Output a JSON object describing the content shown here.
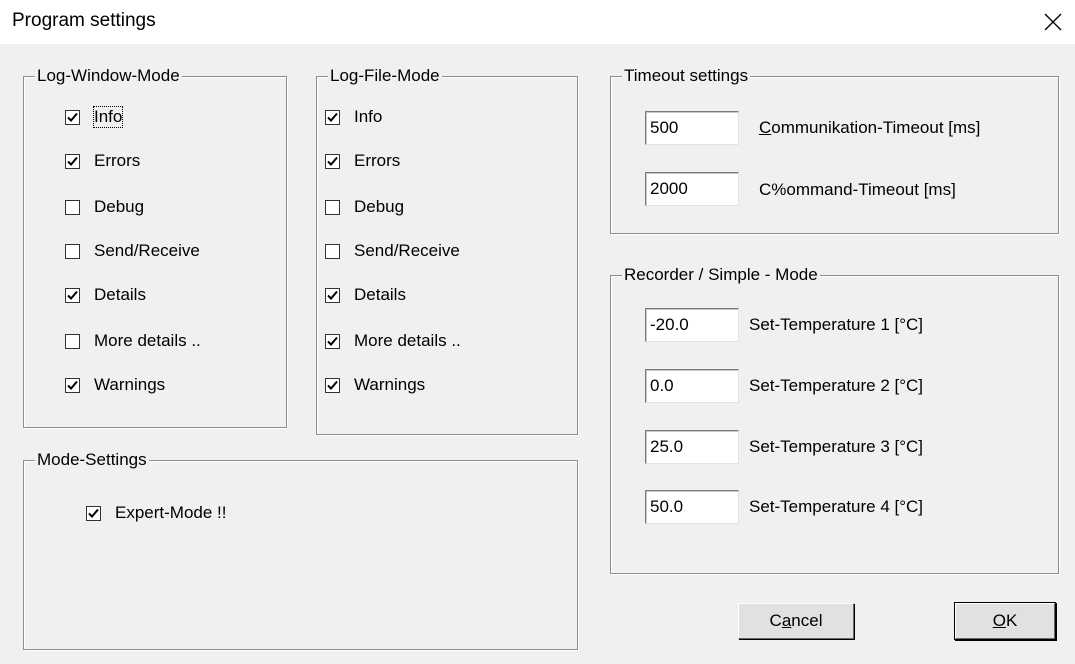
{
  "window": {
    "title": "Program settings"
  },
  "log_window_mode": {
    "legend": "Log-Window-Mode",
    "items": [
      {
        "label": "Info",
        "checked": true
      },
      {
        "label": "Errors",
        "checked": true
      },
      {
        "label": "Debug",
        "checked": false
      },
      {
        "label": "Send/Receive",
        "checked": false
      },
      {
        "label": "Details",
        "checked": true
      },
      {
        "label": "More details ..",
        "checked": false
      },
      {
        "label": "Warnings",
        "checked": true
      }
    ]
  },
  "log_file_mode": {
    "legend": "Log-File-Mode",
    "items": [
      {
        "label": "Info",
        "checked": true
      },
      {
        "label": "Errors",
        "checked": true
      },
      {
        "label": "Debug",
        "checked": false
      },
      {
        "label": "Send/Receive",
        "checked": false
      },
      {
        "label": "Details",
        "checked": true
      },
      {
        "label": "More details ..",
        "checked": true
      },
      {
        "label": "Warnings",
        "checked": true
      }
    ]
  },
  "timeout_settings": {
    "legend": "Timeout settings",
    "communication": {
      "value": "500",
      "label_first": "C",
      "label_rest": "ommunikation-Timeout [ms]"
    },
    "command": {
      "value": "2000",
      "label": "C%ommand-Timeout [ms]"
    }
  },
  "recorder": {
    "legend": "Recorder / Simple - Mode",
    "temps": [
      {
        "value": "-20.0",
        "label": "Set-Temperature 1  [°C]"
      },
      {
        "value": "0.0",
        "label": "Set-Temperature 2  [°C]"
      },
      {
        "value": "25.0",
        "label": "Set-Temperature 3  [°C]"
      },
      {
        "value": "50.0",
        "label": "Set-Temperature 4  [°C]"
      }
    ]
  },
  "mode_settings": {
    "legend": "Mode-Settings",
    "expert": {
      "label": "Expert-Mode !!",
      "checked": true
    }
  },
  "buttons": {
    "cancel_pre": "C",
    "cancel_ul": "a",
    "cancel_post": "ncel",
    "ok_ul": "O",
    "ok_post": "K"
  }
}
